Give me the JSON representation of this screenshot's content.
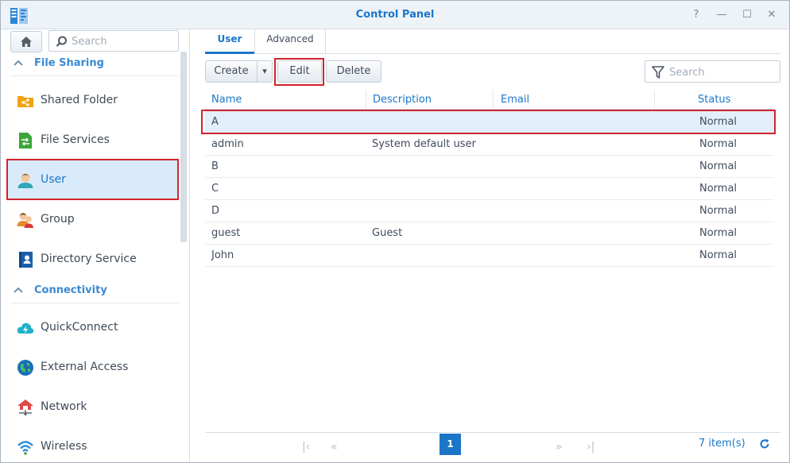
{
  "window": {
    "title": "Control Panel",
    "help_icon": "?",
    "minimize_icon": "—",
    "maximize_icon": "☐",
    "close_icon": "✕"
  },
  "sidebar": {
    "search_placeholder": "Search",
    "sections": [
      {
        "label": "File Sharing",
        "items": [
          {
            "label": "Shared Folder",
            "icon": "shared-folder-icon"
          },
          {
            "label": "File Services",
            "icon": "file-services-icon"
          },
          {
            "label": "User",
            "icon": "user-icon",
            "selected": true
          },
          {
            "label": "Group",
            "icon": "group-icon"
          },
          {
            "label": "Directory Service",
            "icon": "directory-service-icon"
          }
        ]
      },
      {
        "label": "Connectivity",
        "items": [
          {
            "label": "QuickConnect",
            "icon": "quickconnect-icon"
          },
          {
            "label": "External Access",
            "icon": "external-access-icon"
          },
          {
            "label": "Network",
            "icon": "network-icon"
          },
          {
            "label": "Wireless",
            "icon": "wireless-icon"
          }
        ]
      }
    ]
  },
  "tabs": [
    {
      "label": "User",
      "active": true
    },
    {
      "label": "Advanced",
      "active": false
    }
  ],
  "toolbar": {
    "create_label": "Create",
    "create_dropdown_icon": "▾",
    "edit_label": "Edit",
    "delete_label": "Delete",
    "search_placeholder": "Search"
  },
  "grid": {
    "columns": [
      "Name",
      "Description",
      "Email",
      "Status"
    ],
    "rows": [
      {
        "name": "A",
        "description": "",
        "email": "",
        "status": "Normal",
        "selected": true
      },
      {
        "name": "admin",
        "description": "System default user",
        "email": "",
        "status": "Normal"
      },
      {
        "name": "B",
        "description": "",
        "email": "",
        "status": "Normal"
      },
      {
        "name": "C",
        "description": "",
        "email": "",
        "status": "Normal"
      },
      {
        "name": "D",
        "description": "",
        "email": "",
        "status": "Normal"
      },
      {
        "name": "guest",
        "description": "Guest",
        "email": "",
        "status": "Normal"
      },
      {
        "name": "John",
        "description": "",
        "email": "",
        "status": "Normal"
      }
    ]
  },
  "pager": {
    "first_icon": "|‹",
    "prev_icon": "«",
    "current_page": "1",
    "next_icon": "»",
    "last_icon": "›|",
    "items_count": "7 item(s)"
  },
  "colors": {
    "accent": "#1b76c8",
    "highlight": "#d3232b",
    "selected_bg": "#d9ebfb"
  }
}
